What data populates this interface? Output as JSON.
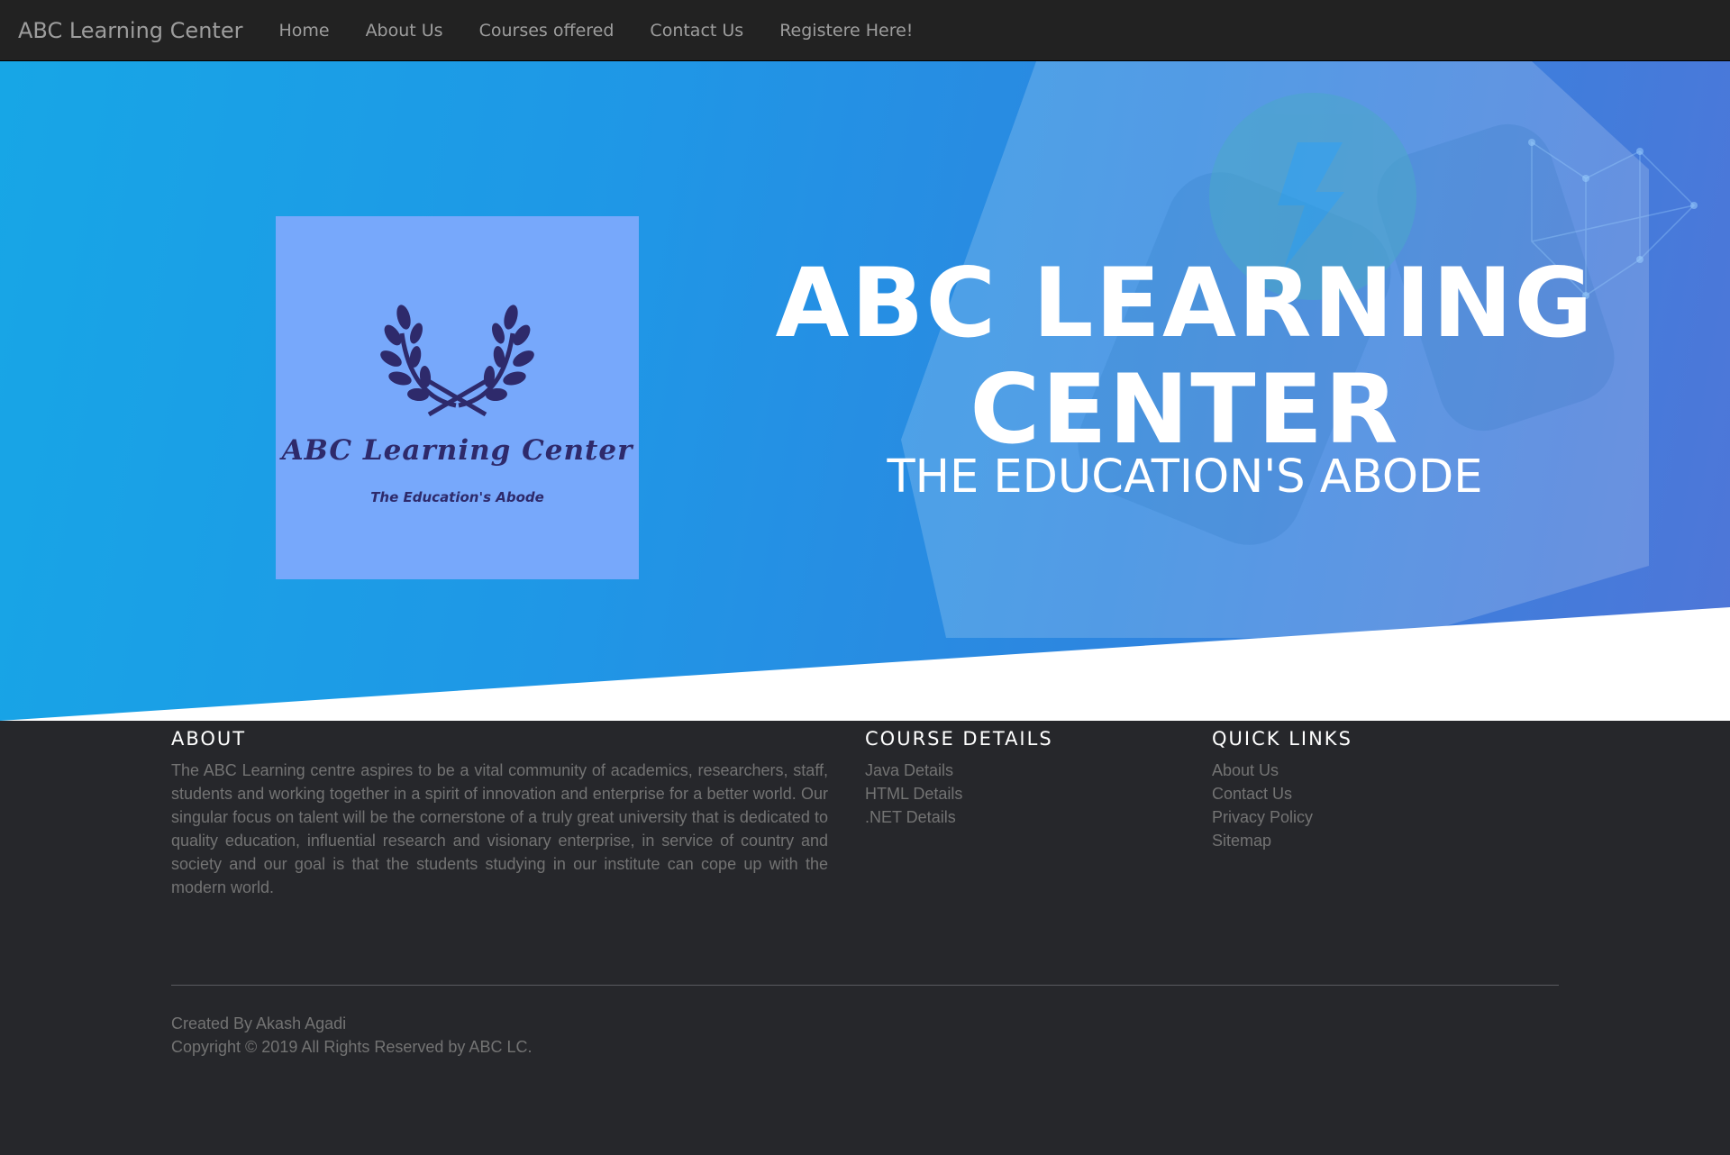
{
  "navbar": {
    "brand": "ABC Learning Center",
    "items": [
      {
        "label": "Home"
      },
      {
        "label": "About Us"
      },
      {
        "label": "Courses offered"
      },
      {
        "label": "Contact Us"
      },
      {
        "label": "Registere Here!"
      }
    ]
  },
  "hero": {
    "logo": {
      "title": "ABC Learning Center",
      "subtitle": "The Education's Abode",
      "icon": "laurel-wreath-icon",
      "background": "#77a8fb"
    },
    "title": "ABC LEARNING CENTER",
    "subtitle": "THE EDUCATION'S ABODE"
  },
  "footer": {
    "about": {
      "heading": "ABOUT",
      "text": "The ABC Learning centre aspires to be a vital community of academics, researchers, staff, students and working together in a spirit of innovation and enterprise for a better world. Our singular focus on talent will be the cornerstone of a truly great university that is dedicated to quality education, influential research and visionary enterprise, in service of country and society and our goal is that the students studying in our institute can cope up with the modern world."
    },
    "course_details": {
      "heading": "COURSE DETAILS",
      "links": [
        {
          "label": "Java Details"
        },
        {
          "label": "HTML Details"
        },
        {
          "label": ".NET Details"
        }
      ]
    },
    "quick_links": {
      "heading": "QUICK LINKS",
      "links": [
        {
          "label": "About Us"
        },
        {
          "label": "Contact Us"
        },
        {
          "label": "Privacy Policy"
        },
        {
          "label": "Sitemap"
        }
      ]
    },
    "credit": "Created By Akash Agadi",
    "copyright": "Copyright © 2019 All Rights Reserved by ABC LC."
  },
  "colors": {
    "navbar_bg": "#222222",
    "footer_bg": "#26272b",
    "hero_blue": "#1f97e6",
    "logo_text": "#2e2a6b"
  }
}
